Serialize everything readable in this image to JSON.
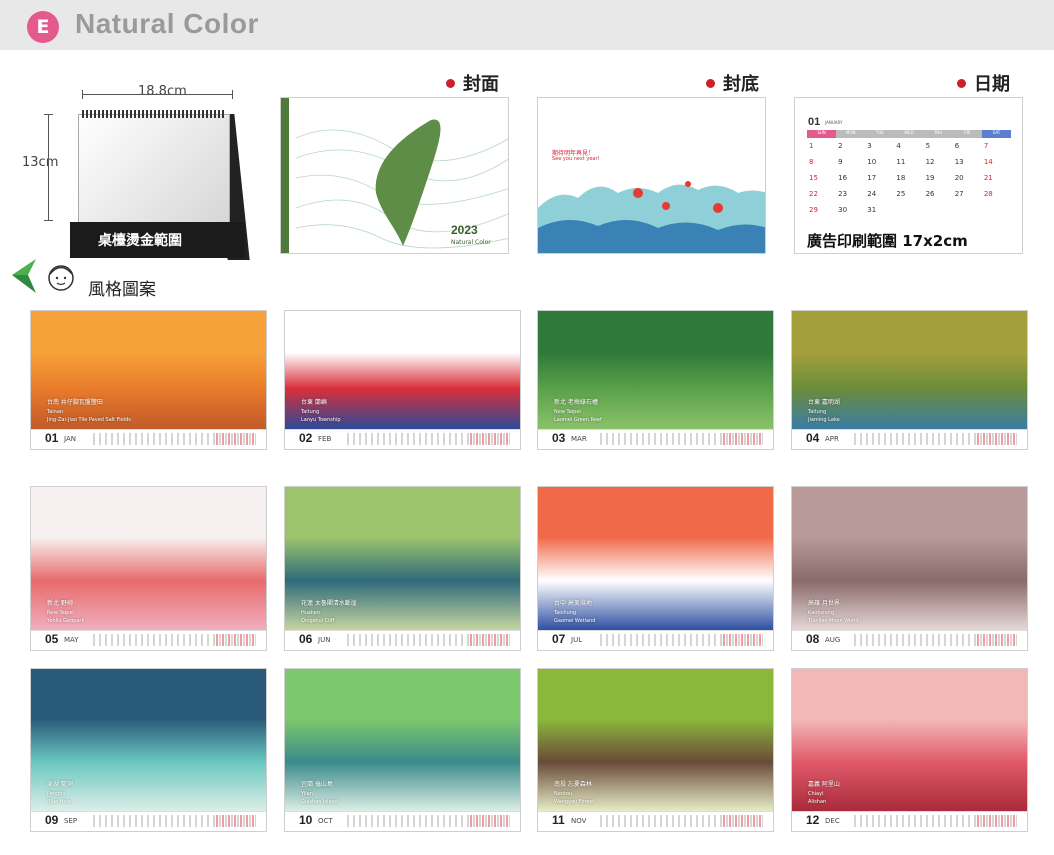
{
  "header": {
    "badge": "E",
    "title": "Natural Color"
  },
  "labels": {
    "cover": "封面",
    "back": "封底",
    "date": "日期"
  },
  "product": {
    "width": "18.8cm",
    "height": "13cm",
    "print_label": "桌檯燙金範圍"
  },
  "style_heading": "風格圖案",
  "ad_range": "廣告印刷範圍 17x2cm",
  "cover": {
    "year": "2023",
    "subtitle": "Natural Color"
  },
  "back_cover": {
    "line1": "期待明年再見！",
    "line2": "See you next year!"
  },
  "date_sample": {
    "month": "01",
    "month_name": "JANUARY",
    "weekdays": [
      "SUN",
      "MON",
      "TUE",
      "WED",
      "THU",
      "FRI",
      "SAT"
    ],
    "rows": [
      [
        "1",
        "2",
        "3",
        "4",
        "5",
        "6",
        "7"
      ],
      [
        "8",
        "9",
        "10",
        "11",
        "12",
        "13",
        "14"
      ],
      [
        "15",
        "16",
        "17",
        "18",
        "19",
        "20",
        "21"
      ],
      [
        "22",
        "23",
        "24",
        "25",
        "26",
        "27",
        "28"
      ],
      [
        "29",
        "30",
        "31",
        "",
        "",
        "",
        ""
      ]
    ]
  },
  "colors": {
    "accent": "#e55a8c",
    "dot": "#cc1f2a",
    "cover_green": "#4e7a3c"
  },
  "months": [
    {
      "num": "01",
      "abbr": "JAN",
      "cap_zh": "台南 井仔腳瓦盤鹽田",
      "cap_en": "Tainan\nJing-Zai-Jiao Tile Paved Salt Fields"
    },
    {
      "num": "02",
      "abbr": "FEB",
      "cap_zh": "台東 蘭嶼",
      "cap_en": "Taitung\nLanyu Township"
    },
    {
      "num": "03",
      "abbr": "MAR",
      "cap_zh": "新北 老梅綠石槽",
      "cap_en": "New Taipei\nLaomei Green Reef"
    },
    {
      "num": "04",
      "abbr": "APR",
      "cap_zh": "台東 嘉明湖",
      "cap_en": "Taitung\nJiaming Lake"
    },
    {
      "num": "05",
      "abbr": "MAY",
      "cap_zh": "新北 野柳",
      "cap_en": "New Taipei\nYehliu Geopark"
    },
    {
      "num": "06",
      "abbr": "JUN",
      "cap_zh": "花蓮 太魯閣清水斷崖",
      "cap_en": "Hualien\nQingshui Cliff"
    },
    {
      "num": "07",
      "abbr": "JUL",
      "cap_zh": "台中 高美濕地",
      "cap_en": "Taichung\nGaomei Wetland"
    },
    {
      "num": "08",
      "abbr": "AUG",
      "cap_zh": "高雄 月世界",
      "cap_en": "Kaohsiung\nTianliao Moon World"
    },
    {
      "num": "09",
      "abbr": "SEP",
      "cap_zh": "澎湖 藍洞",
      "cap_en": "Penghu\nBlue Hole"
    },
    {
      "num": "10",
      "abbr": "OCT",
      "cap_zh": "宜蘭 龜山島",
      "cap_en": "Yilan\nGuishan Island"
    },
    {
      "num": "11",
      "abbr": "NOV",
      "cap_zh": "南投 忘憂森林",
      "cap_en": "Nantou\nWangyou Forest"
    },
    {
      "num": "12",
      "abbr": "DEC",
      "cap_zh": "嘉義 阿里山",
      "cap_en": "Chiayi\nAlishan"
    }
  ]
}
